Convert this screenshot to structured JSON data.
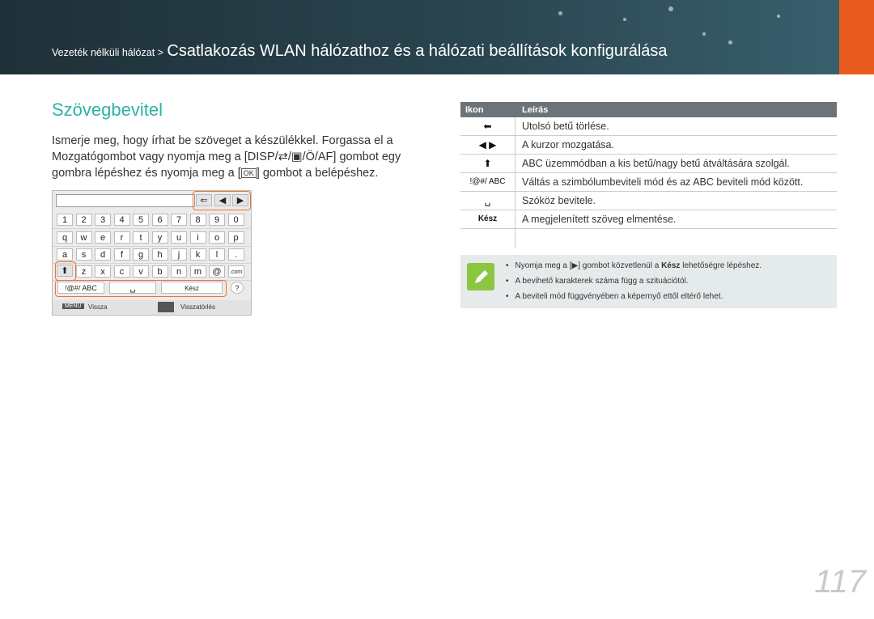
{
  "header": {
    "breadcrumb_section": "Vezeték nélküli hálózat >",
    "breadcrumb_title": "Csatlakozás WLAN hálózathoz és a hálózati beállítások konfigurálása"
  },
  "section_title": "Szövegbevitel",
  "intro": {
    "line1": "Ismerje meg, hogy írhat be szöveget a készülékkel. Forgassa el a",
    "line2_pre": "Mozgatógombot vagy nyomja meg a [",
    "line2_keys": "DISP/⇄/▣/Ö/AF",
    "line2_post": "] gombot egy",
    "line3_pre": "gombra lépéshez és nyomja meg a [",
    "line3_ok": "OK",
    "line3_post": "] gombot a belépéshez."
  },
  "keyboard": {
    "row1": [
      "1",
      "2",
      "3",
      "4",
      "5",
      "6",
      "7",
      "8",
      "9",
      "0"
    ],
    "row2": [
      "q",
      "w",
      "e",
      "r",
      "t",
      "y",
      "u",
      "i",
      "o",
      "p"
    ],
    "row3": [
      "a",
      "s",
      "d",
      "f",
      "g",
      "h",
      "j",
      "k",
      "l",
      "."
    ],
    "row4": [
      "z",
      "x",
      "c",
      "v",
      "b",
      "n",
      "m",
      "@",
      ".com"
    ],
    "mode_label": "!@#/ ABC",
    "done_label": "Kész",
    "footer_menu": "MENU",
    "footer_back": "Vissza",
    "footer_delete": "Visszatörlés"
  },
  "table": {
    "col_icon": "Ikon",
    "col_desc": "Leírás",
    "rows": [
      {
        "icon": "⬅",
        "desc": "Utolsó betű törlése."
      },
      {
        "icon": "◀ ▶",
        "desc": "A kurzor mozgatása."
      },
      {
        "icon": "⬆",
        "desc": "ABC üzemmódban a kis betű/nagy betű átváltására szolgál."
      },
      {
        "icon": "!@#/ ABC",
        "desc": "Váltás a szimbólumbeviteli mód és az ABC beviteli mód között."
      },
      {
        "icon": "␣",
        "desc": "Szóköz bevitele."
      },
      {
        "icon": "Kész",
        "desc": "A megjelenített szöveg elmentése."
      }
    ]
  },
  "note": {
    "item1_pre": "Nyomja meg a [▶] gombot közvetlenül a ",
    "item1_bold": "Kész",
    "item1_post": " lehetőségre lépéshez.",
    "item2": "A bevihető karakterek száma függ a szituációtól.",
    "item3": "A beviteli mód függvényében a képernyő ettől eltérő lehet."
  },
  "page_number": "117",
  "colors": {
    "accent": "#2cb3a5",
    "highlight": "#e8762c",
    "header_bg": "#2a4550",
    "note_icon": "#8cc540"
  }
}
